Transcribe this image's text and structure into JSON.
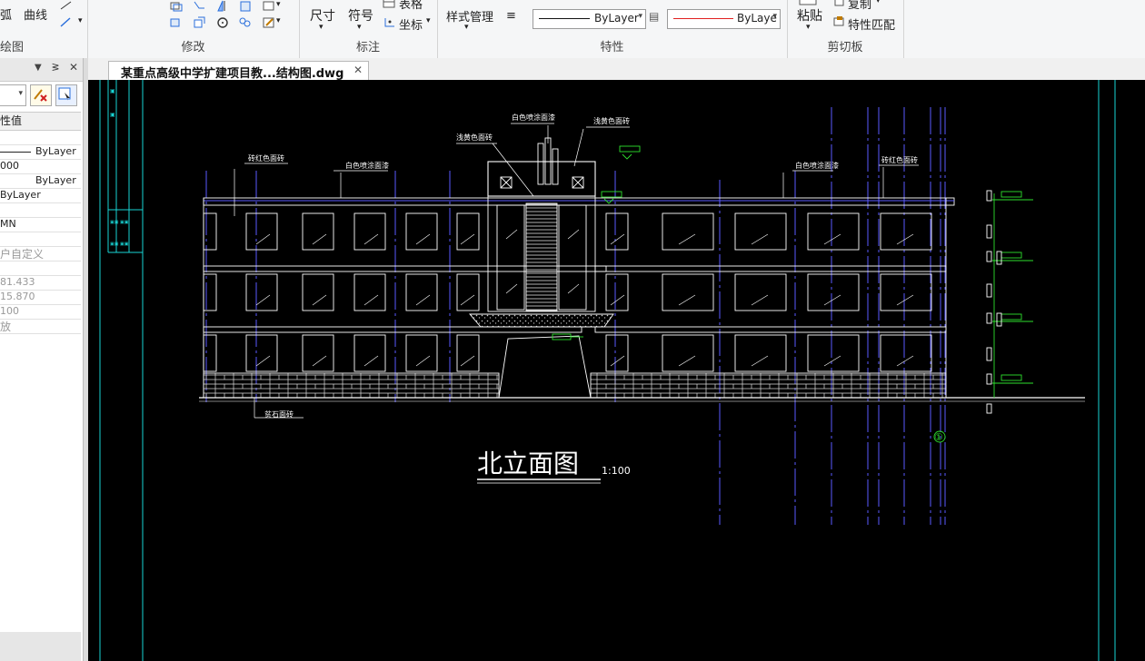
{
  "ribbon": {
    "draw_group": {
      "title": "绘图",
      "arc_label": "弧",
      "curve_label": "曲线"
    },
    "modify_group": {
      "title": "修改"
    },
    "annotate_group": {
      "title": "标注",
      "dim_label": "尺寸",
      "symbol_label": "符号",
      "table_label": "表格",
      "coord_label": "坐标"
    },
    "props_group": {
      "title": "特性",
      "style_label": "样式管理",
      "linetype_value": "ByLayer",
      "color_value": "ByLaye"
    },
    "clipboard_group": {
      "title": "剪切板",
      "paste_label": "粘贴",
      "copy_label": "复制",
      "match_label": "特性匹配"
    }
  },
  "panel": {
    "header": "性值",
    "rows": [
      "ByLayer",
      "000",
      "ByLayer",
      "ByLayer",
      "",
      "MN",
      "",
      "户自定义",
      "",
      "81.433",
      "15.870",
      "100",
      "放"
    ]
  },
  "tabs": [
    {
      "label": "某重点高级中学扩建项目教...结构图.dwg",
      "close": "✕"
    }
  ],
  "drawing": {
    "title": "北立面图",
    "scale": "1:100",
    "annotations": [
      "浅黄色面砖",
      "白色喷涂面漆",
      "砖红色面砖",
      "白色喷涂面漆",
      "浅黄色面砖",
      "白色喷涂面漆",
      "砖红色面砖",
      "贫石面砖"
    ],
    "axis_marker": "①"
  },
  "colors": {
    "canvas_bg": "#000000",
    "line_white": "#ffffff",
    "line_blue": "#5a5aff",
    "line_cyan": "#19d4d4",
    "line_green": "#2ee02e"
  }
}
